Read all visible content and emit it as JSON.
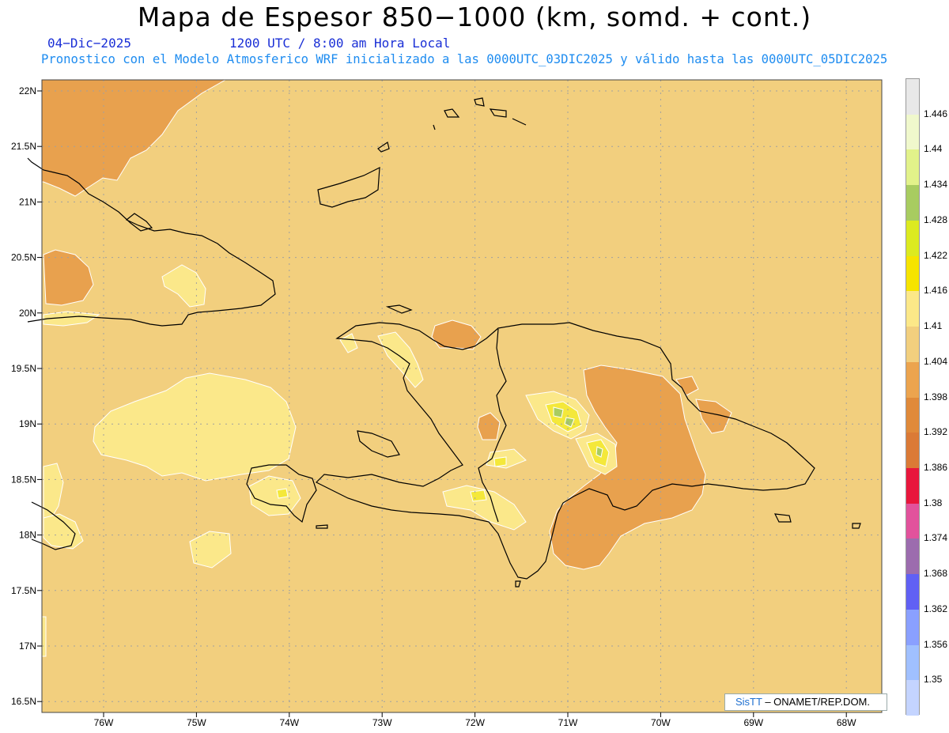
{
  "title": "Mapa de Espesor 850−1000 (km, somd. + cont.)",
  "date": "04−Dic−2025",
  "time": "1200 UTC / 8:00 am Hora Local",
  "info": "Pronostico con el Modelo Atmosferico WRF inicializado a las 0000UTC_03DIC2025 y válido hasta las  0000UTC_05DIC2025",
  "credit": {
    "brand": "SisTT",
    "org": " – ONAMET/REP.DOM."
  },
  "lat_labels": [
    "22N",
    "21.5N",
    "21N",
    "20.5N",
    "20N",
    "19.5N",
    "19N",
    "18.5N",
    "18N",
    "17.5N",
    "17N",
    "16.5N"
  ],
  "lon_labels": [
    "76W",
    "75W",
    "74W",
    "73W",
    "72W",
    "71W",
    "70W",
    "69W",
    "68W"
  ],
  "colorbar": {
    "labels": [
      "1.446",
      "1.44",
      "1.434",
      "1.428",
      "1.422",
      "1.416",
      "1.41",
      "1.404",
      "1.398",
      "1.392",
      "1.386",
      "1.38",
      "1.374",
      "1.368",
      "1.362",
      "1.356",
      "1.35"
    ],
    "colors": [
      "#e8e8e8",
      "#f0f8cc",
      "#e2f28a",
      "#a8cc60",
      "#dcea20",
      "#f6e400",
      "#fce888",
      "#f2cf7e",
      "#eca44e",
      "#e08a3a",
      "#db7a36",
      "#e8163c",
      "#e2529c",
      "#9c6cae",
      "#6060f4",
      "#8aa0ff",
      "#a0c0ff",
      "#c4d4ff"
    ]
  },
  "legend_colors": {
    "base": "#f2cf7e",
    "warm": "#e8a14e",
    "light": "#fbe88a",
    "yellow": "#f4e83a",
    "green": "#a8cc60"
  }
}
